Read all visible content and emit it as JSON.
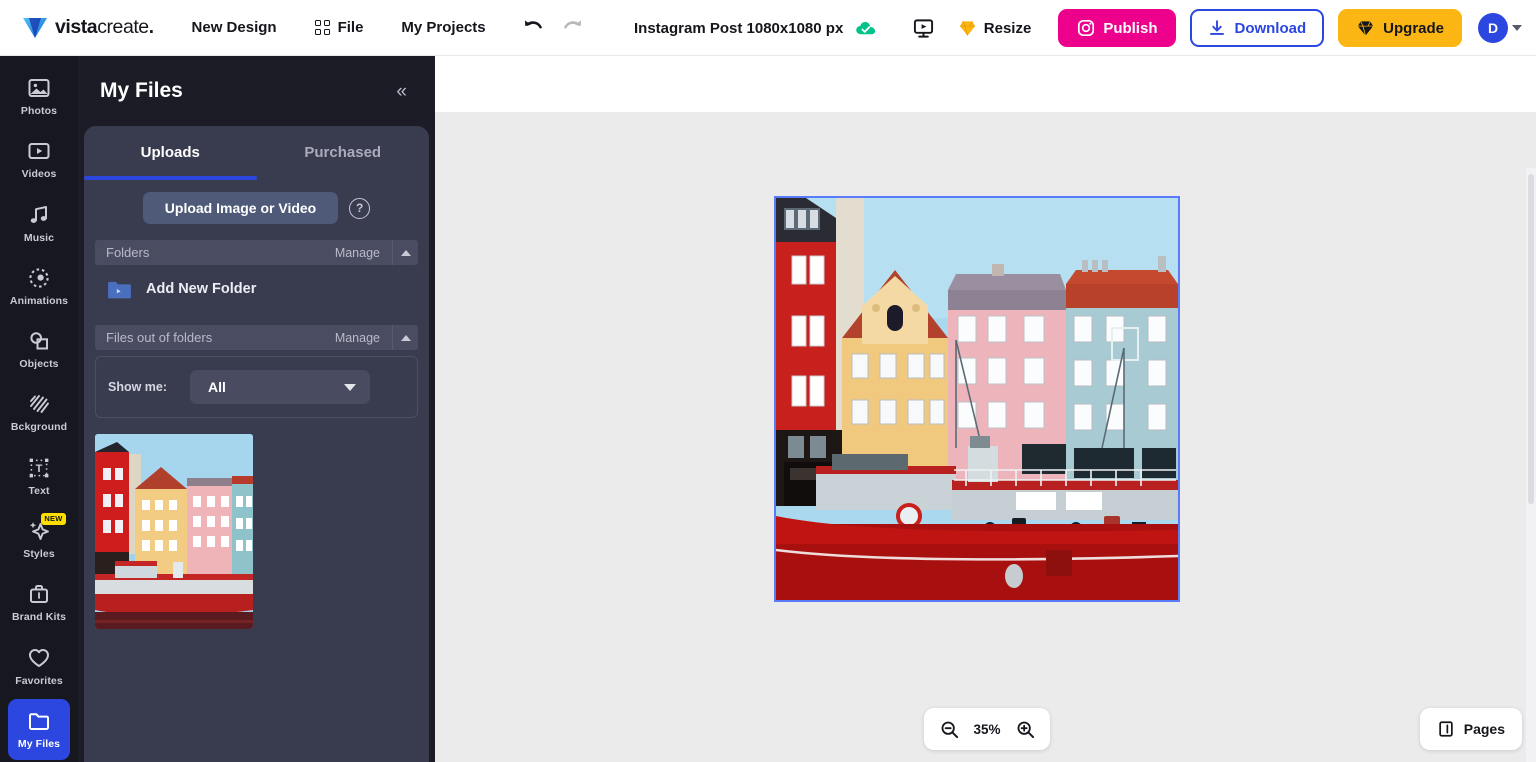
{
  "header": {
    "brand": {
      "name_bold": "vista",
      "name_thin": "create",
      "trailing_dot": "."
    },
    "nav": [
      {
        "label": "New Design",
        "icon": ""
      },
      {
        "label": "File",
        "icon": "grid-icon"
      },
      {
        "label": "My Projects",
        "icon": ""
      }
    ],
    "undo_label": "undo-icon",
    "redo_label": "redo-icon",
    "document_title": "Instagram Post 1080x1080 px",
    "save_status_icon": "cloud-check-icon",
    "present_icon": "presentation-icon",
    "resize_label": "Resize",
    "publish_label": "Publish",
    "download_label": "Download",
    "upgrade_label": "Upgrade",
    "avatar_initial": "D",
    "colors": {
      "publish": "#EC008C",
      "download_border": "#2C47E0",
      "upgrade": "#FCB614",
      "avatar": "#2C47E0",
      "cloud_saved": "#00C389"
    }
  },
  "rail": {
    "items": [
      {
        "label": "Photos",
        "icon": "photo-icon",
        "active": false,
        "badge": ""
      },
      {
        "label": "Videos",
        "icon": "video-icon",
        "active": false,
        "badge": ""
      },
      {
        "label": "Music",
        "icon": "music-icon",
        "active": false,
        "badge": ""
      },
      {
        "label": "Animations",
        "icon": "animation-icon",
        "active": false,
        "badge": ""
      },
      {
        "label": "Objects",
        "icon": "objects-icon",
        "active": false,
        "badge": ""
      },
      {
        "label": "Bckground",
        "icon": "background-icon",
        "active": false,
        "badge": ""
      },
      {
        "label": "Text",
        "icon": "text-icon",
        "active": false,
        "badge": ""
      },
      {
        "label": "Styles",
        "icon": "styles-icon",
        "active": false,
        "badge": "NEW"
      },
      {
        "label": "Brand Kits",
        "icon": "briefcase-icon",
        "active": false,
        "badge": ""
      },
      {
        "label": "Favorites",
        "icon": "heart-icon",
        "active": false,
        "badge": ""
      },
      {
        "label": "My Files",
        "icon": "folder-icon",
        "active": true,
        "badge": ""
      }
    ]
  },
  "panel": {
    "title": "My Files",
    "collapse_icon": "«",
    "tabs": [
      {
        "label": "Uploads",
        "active": true
      },
      {
        "label": "Purchased",
        "active": false
      }
    ],
    "upload_button": "Upload Image or Video",
    "help_icon": "?",
    "sections": [
      {
        "title": "Folders",
        "manage": "Manage",
        "chevron": "chevron-up-icon"
      },
      {
        "title": "Files out of folders",
        "manage": "Manage",
        "chevron": "chevron-up-icon"
      }
    ],
    "add_folder_label": "Add New Folder",
    "filter": {
      "label": "Show me:",
      "selected": "All"
    },
    "thumbnails": [
      {
        "name": "nyhavn-copenhagen-harbor-thumbnail"
      }
    ]
  },
  "canvas": {
    "zoom_level": "35%",
    "zoom_out_icon": "zoom-out-icon",
    "zoom_in_icon": "zoom-in-icon",
    "pages_label": "Pages",
    "pages_icon": "pages-icon",
    "artboard": {
      "name": "nyhavn-copenhagen-harbor-image",
      "selected": true,
      "selection_color": "#5B7CFA"
    }
  }
}
